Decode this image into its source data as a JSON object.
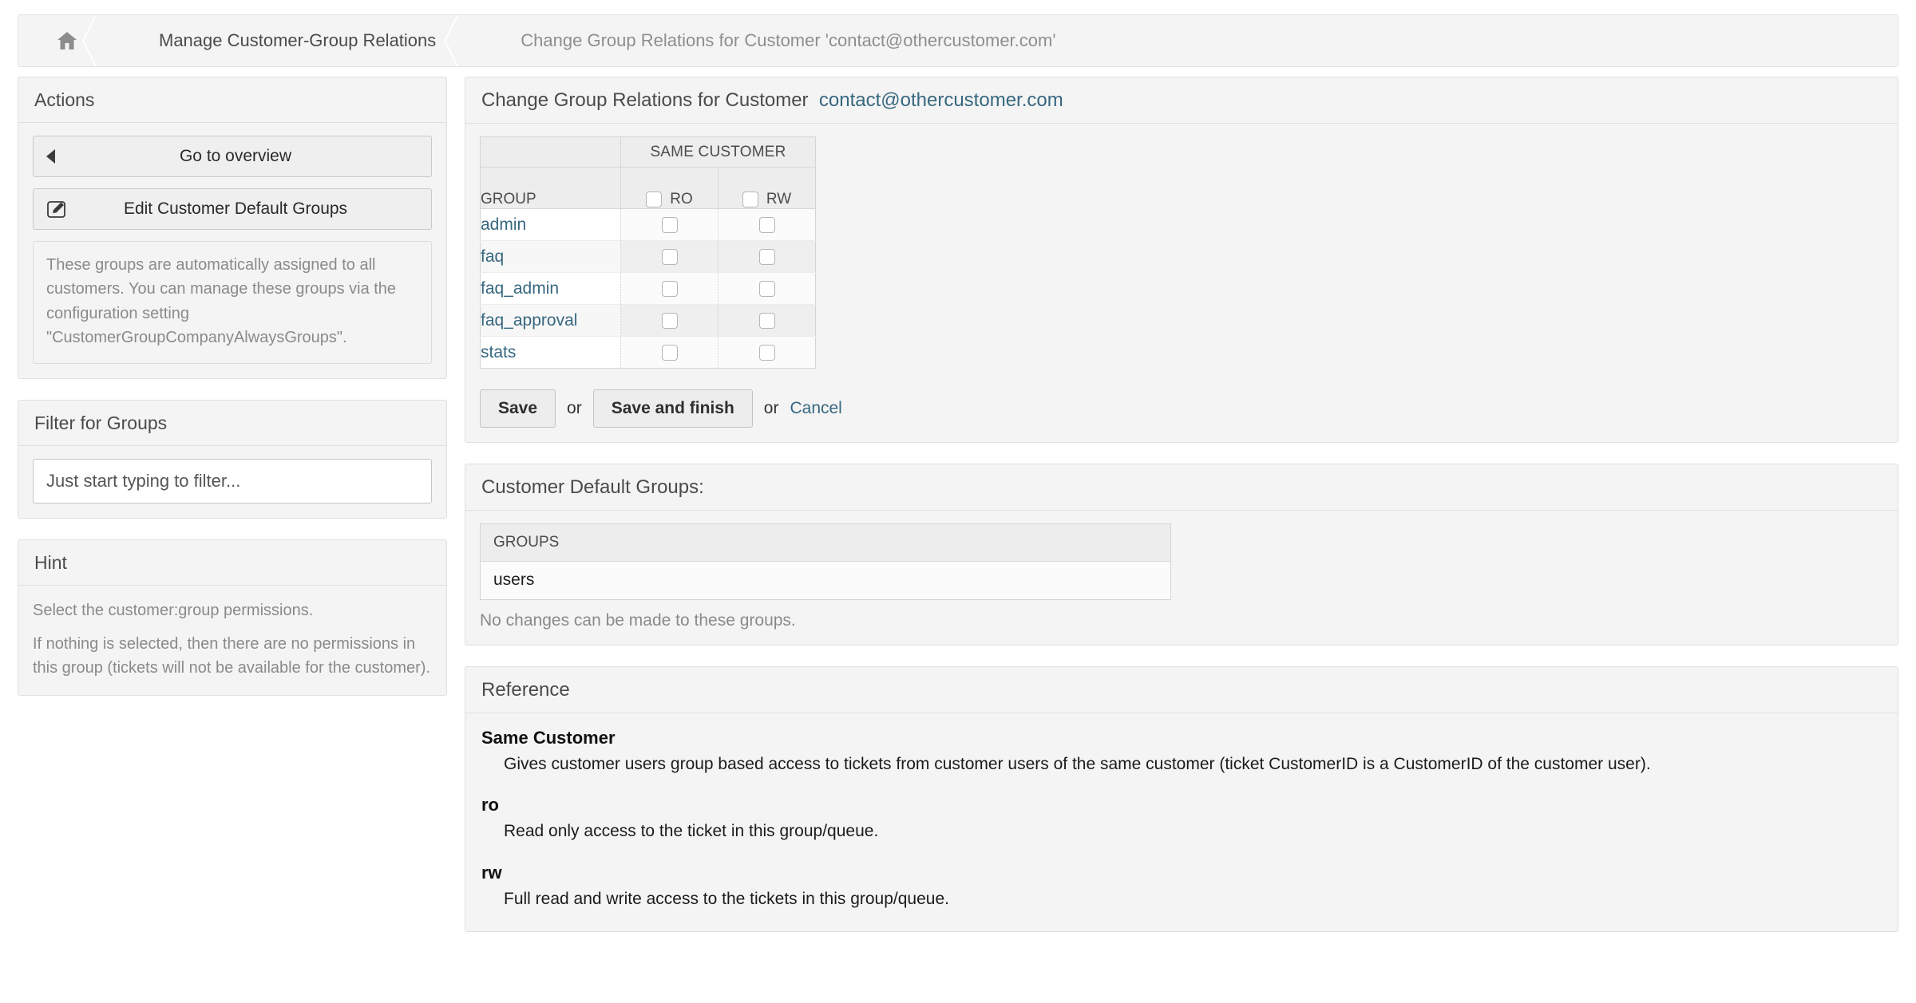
{
  "breadcrumb": {
    "home_icon": "home-icon",
    "items": [
      {
        "label": "Manage Customer-Group Relations"
      },
      {
        "label": "Change Group Relations for Customer 'contact@othercustomer.com'"
      }
    ]
  },
  "sidebar": {
    "actions": {
      "title": "Actions",
      "go_to_overview": "Go to overview",
      "edit_defaults": "Edit Customer Default Groups",
      "info": "These groups are automatically assigned to all customers. You can manage these groups via the configuration setting \"CustomerGroupCompanyAlwaysGroups\"."
    },
    "filter": {
      "title": "Filter for Groups",
      "placeholder": "Just start typing to filter...",
      "value": ""
    },
    "hint": {
      "title": "Hint",
      "line1": "Select the customer:group permissions.",
      "line2": "If nothing is selected, then there are no permissions in this group (tickets will not be available for the customer)."
    }
  },
  "main": {
    "relations": {
      "title_prefix": "Change Group Relations for Customer",
      "customer": "contact@othercustomer.com",
      "table": {
        "group_header": "GROUP",
        "span_header": "SAME CUSTOMER",
        "perm_columns": [
          {
            "key": "ro",
            "label": "RO"
          },
          {
            "key": "rw",
            "label": "RW"
          }
        ],
        "rows": [
          {
            "group": "admin",
            "ro": false,
            "rw": false
          },
          {
            "group": "faq",
            "ro": false,
            "rw": false
          },
          {
            "group": "faq_admin",
            "ro": false,
            "rw": false
          },
          {
            "group": "faq_approval",
            "ro": false,
            "rw": false
          },
          {
            "group": "stats",
            "ro": false,
            "rw": false
          }
        ]
      },
      "submit": {
        "save": "Save",
        "or1": "or",
        "save_and_finish": "Save and finish",
        "or2": "or",
        "cancel": "Cancel"
      }
    },
    "default_groups": {
      "title": "Customer Default Groups:",
      "column_header": "GROUPS",
      "rows": [
        "users"
      ],
      "note": "No changes can be made to these groups."
    },
    "reference": {
      "title": "Reference",
      "entries": [
        {
          "term": "Same Customer",
          "definition": "Gives customer users group based access to tickets from customer users of the same customer (ticket CustomerID is a CustomerID of the customer user)."
        },
        {
          "term": "ro",
          "definition": "Read only access to the ticket in this group/queue."
        },
        {
          "term": "rw",
          "definition": "Full read and write access to the tickets in this group/queue."
        }
      ]
    }
  },
  "colors": {
    "link": "#36677f",
    "panel_bg": "#f4f4f4",
    "muted_text": "#8a8a8a"
  }
}
